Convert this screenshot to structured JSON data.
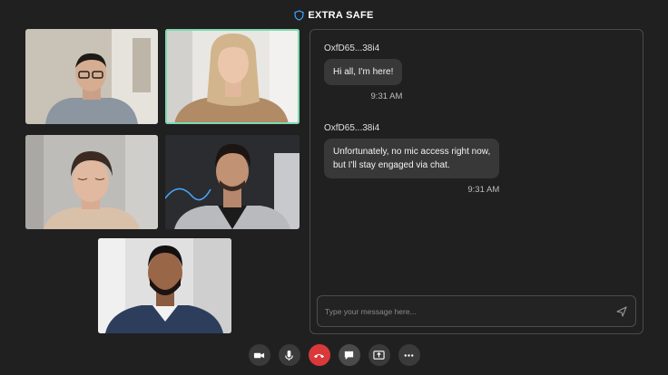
{
  "app": {
    "title": "EXTRA SAFE",
    "accent_color": "#3ea6ff"
  },
  "participants": [
    {
      "name": "participant-1",
      "speaking": false
    },
    {
      "name": "participant-2",
      "speaking": true
    },
    {
      "name": "participant-3",
      "speaking": false
    },
    {
      "name": "participant-4",
      "speaking": false
    },
    {
      "name": "participant-5",
      "speaking": false
    }
  ],
  "chat": {
    "messages": [
      {
        "sender": "OxfD65...38i4",
        "text": "Hi all, I'm here!",
        "time": "9:31 AM"
      },
      {
        "sender": "OxfD65...38i4",
        "text_lines": [
          "Unfortunately, no mic access right now,",
          "but I'll stay engaged via chat."
        ],
        "time": "9:31 AM"
      }
    ],
    "input": {
      "placeholder": "Type your message here...",
      "value": ""
    }
  },
  "controls": [
    {
      "icon": "camera-icon"
    },
    {
      "icon": "microphone-icon"
    },
    {
      "icon": "hang-up-icon",
      "color": "#d9393b"
    },
    {
      "icon": "chat-icon"
    },
    {
      "icon": "share-screen-icon"
    },
    {
      "icon": "more-icon"
    }
  ]
}
